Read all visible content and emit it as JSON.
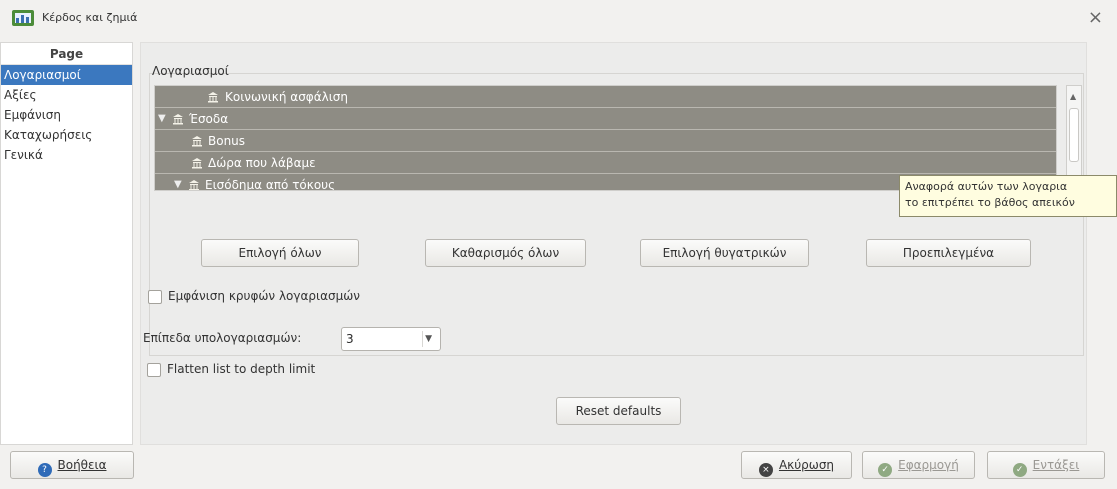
{
  "window": {
    "title": "Κέρδος και ζημιά",
    "close_glyph": "×"
  },
  "sidebar": {
    "header": "Page",
    "items": [
      {
        "label": "Λογαριασμοί",
        "selected": true
      },
      {
        "label": "Αξίες"
      },
      {
        "label": "Εμφάνιση"
      },
      {
        "label": "Καταχωρήσεις"
      },
      {
        "label": "Γενικά"
      }
    ]
  },
  "accounts": {
    "group_label": "Λογαριασμοί",
    "tree_rows": [
      {
        "label": "Κοινωνική ασφάλιση",
        "depth": 2,
        "expander": ""
      },
      {
        "label": "Έσοδα",
        "depth": 0,
        "expander": "▼"
      },
      {
        "label": "Bonus",
        "depth": 1,
        "expander": ""
      },
      {
        "label": "Δώρα που λάβαμε",
        "depth": 1,
        "expander": ""
      },
      {
        "label": "Εισόδημα από τόκους",
        "depth": 1,
        "expander": "▼"
      }
    ],
    "tooltip_lines": [
      "Αναφορά αυτών των λογαρια",
      "το επιτρέπει το βάθος απεικόν"
    ],
    "buttons": {
      "select_all": "Επιλογή όλων",
      "clear_all": "Καθαρισμός όλων",
      "select_children": "Επιλογή θυγατρικών",
      "defaults": "Προεπιλεγμένα"
    },
    "show_hidden_label": "Εμφάνιση κρυφών λογαριασμών",
    "show_hidden_checked": false
  },
  "levels": {
    "label": "Επίπεδα υπολογαριασμών:",
    "value": "3"
  },
  "flatten": {
    "label": "Flatten list to depth limit",
    "checked": false
  },
  "reset_defaults": "Reset defaults",
  "footer": {
    "help": "Βοήθεια",
    "cancel": "Ακύρωση",
    "apply": "Εφαρμογή",
    "ok": "Εντάξει"
  },
  "colors": {
    "selection": "#3b78bf",
    "tree_row_bg": "#8e8c84",
    "tooltip_bg": "#fffde0",
    "help_icon": "#2f6bb8",
    "cancel_icon": "#444444",
    "ok_icon": "#7ea36a"
  },
  "icons": {
    "app": "report-icon",
    "tree_item": "bank-icon",
    "help": "help-icon",
    "cancel": "cancel-icon",
    "apply": "apply-icon",
    "ok": "ok-icon"
  }
}
